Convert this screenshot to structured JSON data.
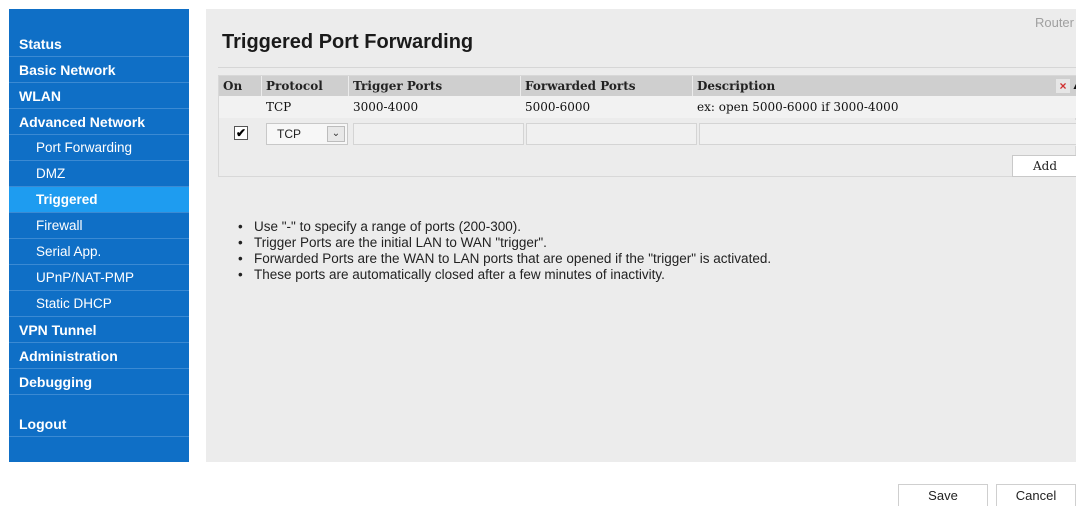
{
  "sidebar": {
    "items": [
      {
        "label": "Status"
      },
      {
        "label": "Basic Network"
      },
      {
        "label": "WLAN"
      },
      {
        "label": "Advanced Network"
      },
      {
        "label": "Port Forwarding"
      },
      {
        "label": "DMZ"
      },
      {
        "label": "Triggered"
      },
      {
        "label": "Firewall"
      },
      {
        "label": "Serial App."
      },
      {
        "label": "UPnP/NAT-PMP"
      },
      {
        "label": "Static DHCP"
      },
      {
        "label": "VPN Tunnel"
      },
      {
        "label": "Administration"
      },
      {
        "label": "Debugging"
      }
    ],
    "logout": "Logout"
  },
  "header": {
    "brand": "Router",
    "title": "Triggered Port Forwarding"
  },
  "table": {
    "columns": [
      "On",
      "Protocol",
      "Trigger Ports",
      "Forwarded Ports",
      "Description"
    ],
    "rows": [
      {
        "on": "",
        "protocol": "TCP",
        "trigger_ports": "3000-4000",
        "forwarded_ports": "5000-6000",
        "description": "ex: open 5000-6000 if 3000-4000"
      }
    ],
    "new_row": {
      "on_checked": "✔",
      "protocol": "TCP",
      "protocol_arrow": "⌄",
      "trigger_ports": "",
      "forwarded_ports": "",
      "description": ""
    },
    "delete_icon": "×",
    "up_icon": "▲",
    "add_label": "Add"
  },
  "notes": [
    "Use \"-\" to specify a range of ports (200-300).",
    "Trigger Ports are the initial LAN to WAN \"trigger\".",
    "Forwarded Ports are the WAN to LAN ports that are opened if the \"trigger\" is activated.",
    "These ports are automatically closed after a few minutes of inactivity."
  ],
  "footer": {
    "save_label": "Save",
    "cancel_label": "Cancel"
  }
}
